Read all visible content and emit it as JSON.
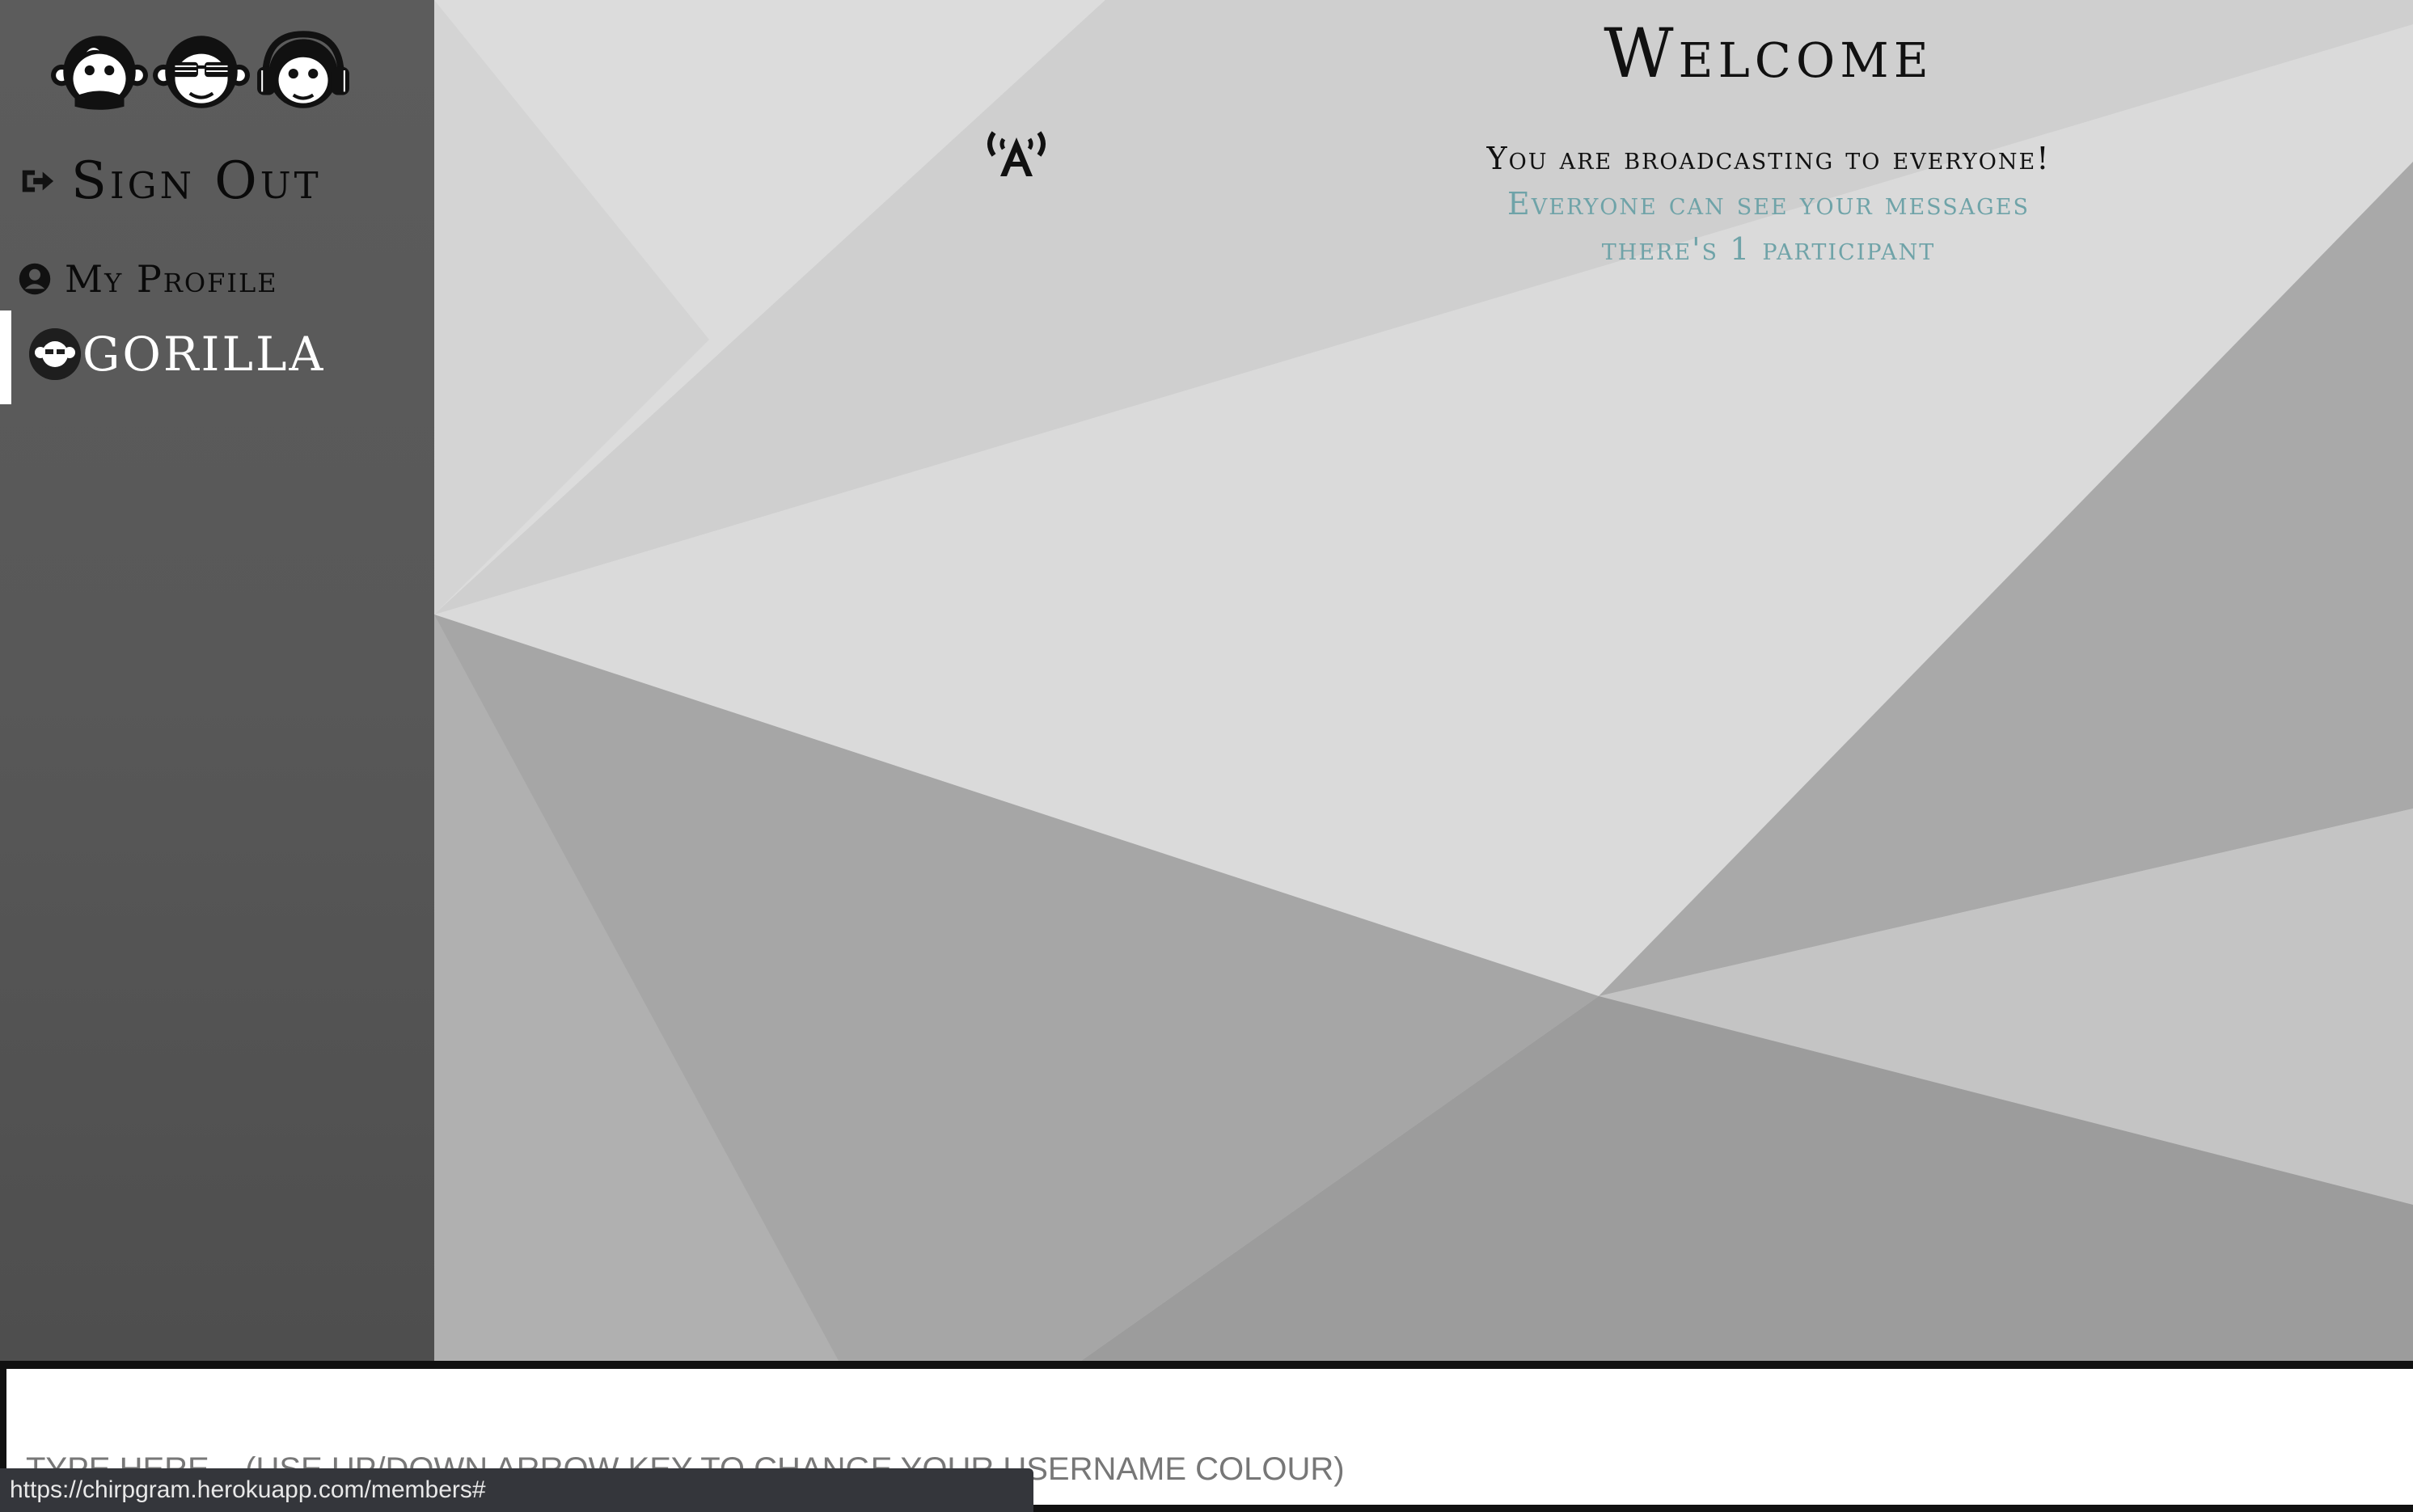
{
  "sidebar": {
    "logo_icons": [
      "monkey-speak-no-evil-icon",
      "monkey-sunglasses-icon",
      "monkey-headphones-icon"
    ],
    "sign_out_label": "Sign Out",
    "my_profile_label": "My Profile",
    "users": [
      {
        "label": "GORILLA",
        "avatar_icon": "gorilla-avatar-icon",
        "active": true
      }
    ]
  },
  "main": {
    "broadcast_icon": "broadcast-antenna-icon",
    "welcome_title": "Welcome",
    "broadcast_text": "You are broadcasting to everyone!",
    "visibility_text": "Everyone can see your messages",
    "participants_text": "there's 1 participant"
  },
  "input": {
    "placeholder": "TYPE HERE... (USE UP/DOWN ARROW KEY TO CHANGE YOUR USERNAME COLOUR)",
    "value": ""
  },
  "status_bar": {
    "url": "https://chirpgram.herokuapp.com/members#"
  },
  "colors": {
    "sidebar_bg": "#585858",
    "accent_teal": "#6fa3a8",
    "text_dark": "#111111",
    "active_indicator": "#ffffff"
  }
}
